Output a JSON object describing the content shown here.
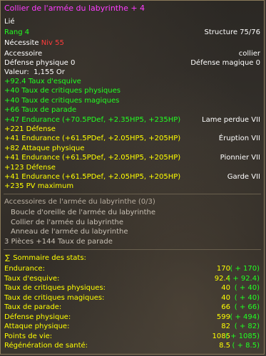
{
  "item": {
    "name": "Collier de l'armée du labyrinthe + 4",
    "bound": "Lié",
    "rank": "Rang 4",
    "structure": "Structure 75/76",
    "requires_label": "Nécessite",
    "requires_level": "Niv 55",
    "type": "Accessoire",
    "slot": "collier",
    "phys_def": "Défense physique 0",
    "mag_def": "Défense magique 0",
    "value_label": "Valeur:",
    "value": "1,155 Or"
  },
  "bonuses": [
    {
      "text": "+92.4 Taux d'esquive",
      "color": "green",
      "right": ""
    },
    {
      "text": "+40 Taux de critiques physiques",
      "color": "green",
      "right": ""
    },
    {
      "text": "+40 Taux de critiques magiques",
      "color": "green",
      "right": ""
    },
    {
      "text": "+66 Taux de parade",
      "color": "green",
      "right": ""
    },
    {
      "text": "+47 Endurance (+70.5PDef, +2.35HP5, +235HP)",
      "color": "green",
      "right": "Lame perdue VII"
    },
    {
      "text": "+221 Défense",
      "color": "yellow",
      "right": ""
    },
    {
      "text": "+41 Endurance (+61.5PDef, +2.05HP5, +205HP)",
      "color": "yellow",
      "right": "Éruption VII"
    },
    {
      "text": "+82 Attaque physique",
      "color": "yellow",
      "right": ""
    },
    {
      "text": "+41 Endurance (+61.5PDef, +2.05HP5, +205HP)",
      "color": "yellow",
      "right": "Pionnier VII"
    },
    {
      "text": "+123 Défense",
      "color": "yellow",
      "right": ""
    },
    {
      "text": "+41 Endurance (+61.5PDef, +2.05HP5, +205HP)",
      "color": "yellow",
      "right": "Garde VII"
    },
    {
      "text": "+235 PV maximum",
      "color": "yellow",
      "right": ""
    }
  ],
  "set": {
    "title": "Accessoires de l'armée du labyrinthe (0/3)",
    "pieces": [
      "Boucle d'oreille de l'armée du labyrinthe",
      "Collier de l'armée du labyrinthe",
      "Anneau de l'armée du labyrinthe"
    ],
    "bonus": "3 Pièces +144 Taux de parade"
  },
  "summary": {
    "title": "Sommaire des stats:",
    "icon": "sigma-icon",
    "rows": [
      {
        "label": "Endurance:",
        "value": "170",
        "delta": "( + 170)"
      },
      {
        "label": "Taux d'esquive:",
        "value": "92.4",
        "delta": "( + 92.4)"
      },
      {
        "label": "Taux de critiques physiques:",
        "value": "40",
        "delta": "( + 40)"
      },
      {
        "label": "Taux de critiques magiques:",
        "value": "40",
        "delta": "( + 40)"
      },
      {
        "label": "Taux de parade:",
        "value": "66",
        "delta": "( + 66)"
      },
      {
        "label": "Défense physique:",
        "value": "599",
        "delta": "( + 494)"
      },
      {
        "label": "Attaque physique:",
        "value": "82",
        "delta": "( + 82)"
      },
      {
        "label": "Points de vie:",
        "value": "1085",
        "delta": "( + 1085)"
      },
      {
        "label": "Régénération de santé:",
        "value": "8.5",
        "delta": "( + 8.5)"
      }
    ]
  },
  "colors": {
    "title": "#ff3cff",
    "green": "#22ff22",
    "yellow": "#ffff00",
    "requirement": "#ff3c3c",
    "border": "#8a7a5a"
  }
}
